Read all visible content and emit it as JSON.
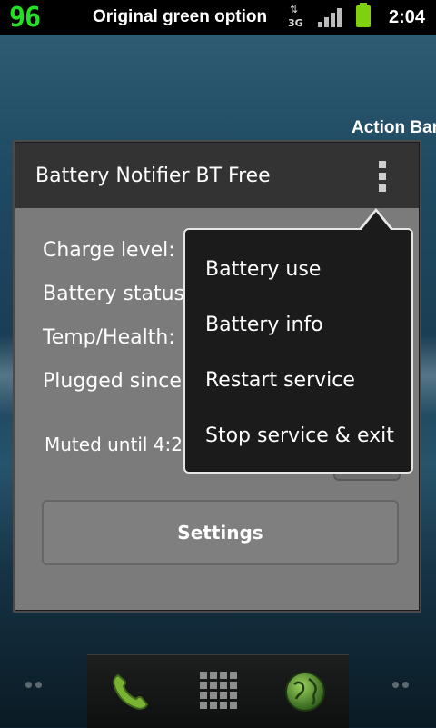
{
  "status_bar": {
    "battery_level": "96",
    "title": "Original green option",
    "network_label": "3G",
    "network_arrows": "⇅",
    "clock": "2:04"
  },
  "action_bar_label": "Action Bar",
  "dialog": {
    "title": "Battery Notifier BT Free",
    "rows": [
      {
        "label": "Charge level:"
      },
      {
        "label": "Battery status:"
      },
      {
        "label": "Temp/Health:"
      },
      {
        "label": "Plugged since"
      }
    ],
    "muted_text": "Muted until 4:2",
    "settings_label": "Settings"
  },
  "menu": {
    "items": [
      {
        "label": "Battery use"
      },
      {
        "label": "Battery info"
      },
      {
        "label": "Restart service"
      },
      {
        "label": "Stop service & exit"
      }
    ]
  },
  "colors": {
    "battery_level_text": "#22e022",
    "battery_icon": "#7ed10f",
    "dialog_header": "#333333",
    "menu_background": "#1b1b1b"
  },
  "icons": [
    "network-3g-icon",
    "signal-strength-icon",
    "battery-icon",
    "overflow-menu-icon",
    "phone-icon",
    "app-drawer-icon",
    "browser-globe-icon"
  ]
}
